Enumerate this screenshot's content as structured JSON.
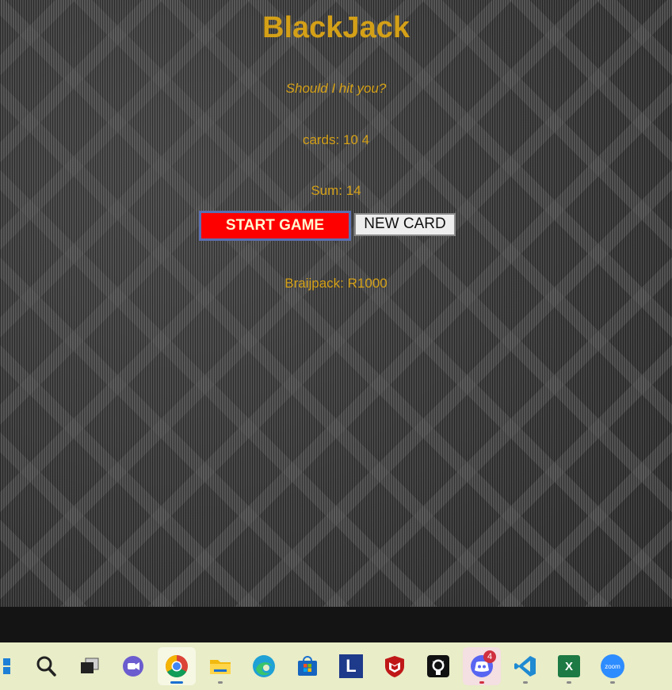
{
  "game": {
    "title": "BlackJack",
    "prompt": "Should I hit you?",
    "cards": "cards: 10 4",
    "sum": "Sum: 14",
    "start_button": "START GAME",
    "new_card_button": "NEW CARD",
    "player": "Braijpack: R1000"
  },
  "taskbar": {
    "discord_badge": "4",
    "excel_letter": "X",
    "zoom_label": "zoom",
    "l_app_letter": "L",
    "items": [
      {
        "name": "windows-start"
      },
      {
        "name": "search"
      },
      {
        "name": "task-view"
      },
      {
        "name": "chat"
      },
      {
        "name": "chrome"
      },
      {
        "name": "file-explorer"
      },
      {
        "name": "edge"
      },
      {
        "name": "microsoft-store"
      },
      {
        "name": "l-app"
      },
      {
        "name": "mcafee"
      },
      {
        "name": "github"
      },
      {
        "name": "discord"
      },
      {
        "name": "vscode"
      },
      {
        "name": "excel"
      },
      {
        "name": "zoom"
      }
    ]
  },
  "colors": {
    "title_gold": "#d4a017",
    "start_red": "#ff0000",
    "taskbar_bg": "#e9edc8"
  }
}
